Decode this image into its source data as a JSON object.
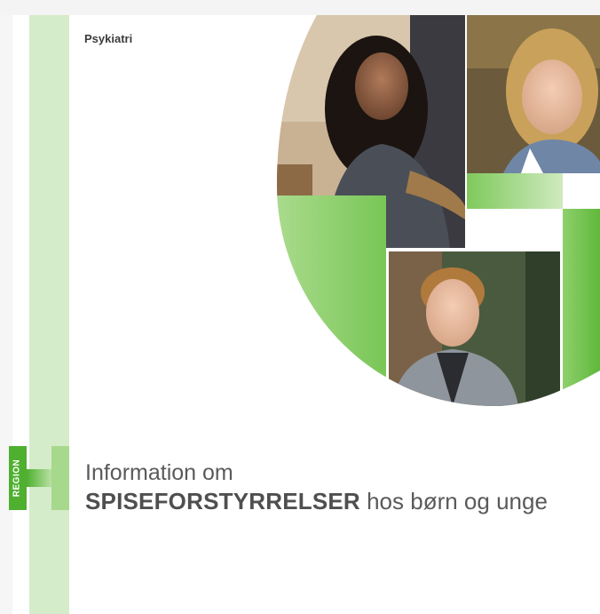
{
  "header": {
    "label": "Psykiatri"
  },
  "logo": {
    "text": "REGION"
  },
  "title": {
    "line1": "Information om",
    "line2_bold": "SPISEFORSTYRRELSER",
    "line2_rest": " hos børn og unge"
  },
  "colors": {
    "accent_green": "#6cc24a",
    "light_green": "#d4ecc9",
    "text_gray": "#5a5a5a"
  },
  "images": [
    {
      "name": "photo-teen-girl",
      "description_icon": "person-photo-icon"
    },
    {
      "name": "photo-young-girl",
      "description_icon": "person-photo-icon"
    },
    {
      "name": "photo-boy",
      "description_icon": "person-photo-icon"
    }
  ]
}
